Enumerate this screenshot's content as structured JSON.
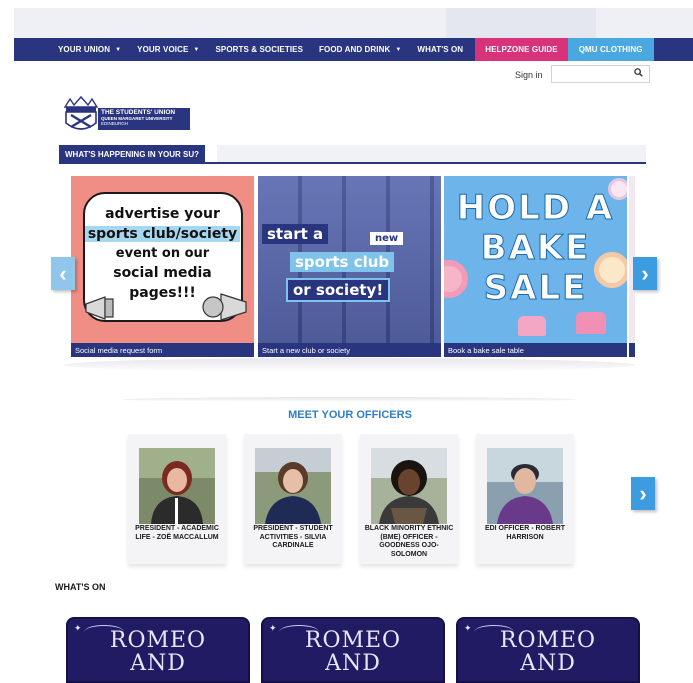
{
  "nav": {
    "items": [
      {
        "label": "YOUR UNION",
        "dropdown": true
      },
      {
        "label": "YOUR VOICE",
        "dropdown": true
      },
      {
        "label": "SPORTS & SOCIETIES",
        "dropdown": false
      },
      {
        "label": "FOOD AND DRINK",
        "dropdown": true
      },
      {
        "label": "WHAT'S ON",
        "dropdown": false
      }
    ],
    "helpzone": "HELPZONE GUIDE",
    "clothing": "QMU CLOTHING",
    "caret": "▼"
  },
  "header": {
    "signin": "Sign in",
    "search_placeholder": "",
    "search_icon": "search-icon"
  },
  "logo": {
    "line1": "THE STUDENTS' UNION",
    "line2": "QUEEN MARGARET UNIVERSITY",
    "line3": "EDINBURGH"
  },
  "whats_happening": {
    "title": "WHAT'S HAPPENING IN YOUR SU?",
    "slides": [
      {
        "caption": "Social media request form",
        "text_lines": [
          "advertise your",
          "sports club/society",
          "event on our",
          "social media",
          "pages!!!"
        ]
      },
      {
        "caption": "Start a new club or society",
        "text_lines": [
          "start a",
          "new",
          "sports club",
          "or society!"
        ]
      },
      {
        "caption": "Book a bake sale table",
        "text_lines": [
          "HOLD A",
          "BAKE",
          "SALE"
        ]
      }
    ],
    "prev_arrow": "‹",
    "next_arrow": "›"
  },
  "officers": {
    "title": "MEET YOUR OFFICERS",
    "cards": [
      {
        "name": "PRESIDENT - ACADEMIC LIFE - ZOË MACCALLUM"
      },
      {
        "name": "PRESIDENT - STUDENT ACTIVITIES - SILVIA CARDINALE"
      },
      {
        "name": "BLACK MINORITY ETHNIC (BME) OFFICER - GOODNESS OJO-SOLOMON"
      },
      {
        "name": "EDI OFFICER - ROBERT HARRISON"
      }
    ],
    "next_arrow": "›"
  },
  "whats_on": {
    "title": "WHAT'S ON",
    "events": [
      {
        "title_lines": [
          "ROMEO",
          "AND"
        ]
      },
      {
        "title_lines": [
          "ROMEO",
          "AND"
        ]
      },
      {
        "title_lines": [
          "ROMEO",
          "AND"
        ]
      }
    ]
  },
  "colors": {
    "nav": "#2a3580",
    "helpzone": "#d8327a",
    "clothing": "#4aa8e0",
    "accent_blue": "#2f7fc6",
    "event_bg": "#201b63"
  }
}
